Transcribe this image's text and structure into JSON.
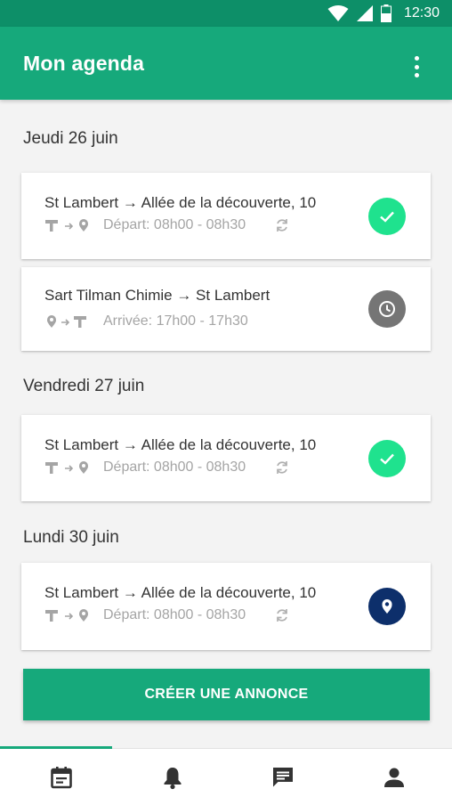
{
  "status_bar": {
    "time": "12:30"
  },
  "app_bar": {
    "title": "Mon agenda"
  },
  "days": [
    {
      "label": "Jeudi 26 juin",
      "trips": [
        {
          "route": "St Lambert → Allée de la découverte, 10",
          "schedule": "Départ: 08h00 - 08h30",
          "direction": "departure",
          "recurring": true,
          "status": "confirmed"
        },
        {
          "route": "Sart Tilman Chimie → St Lambert",
          "schedule": "Arrivée: 17h00 - 17h30",
          "direction": "arrival",
          "recurring": false,
          "status": "pending"
        }
      ]
    },
    {
      "label": "Vendredi 27 juin",
      "trips": [
        {
          "route": "St Lambert → Allée de la découverte, 10",
          "schedule": "Départ: 08h00 - 08h30",
          "direction": "departure",
          "recurring": true,
          "status": "confirmed"
        }
      ]
    },
    {
      "label": "Lundi 30 juin",
      "trips": [
        {
          "route": "St Lambert → Allée de la découverte, 10",
          "schedule": "Départ: 08h00 - 08h30",
          "direction": "departure",
          "recurring": true,
          "status": "location"
        }
      ]
    }
  ],
  "create_button": {
    "label": "CRÉER UNE ANNONCE"
  },
  "bottom_nav": {
    "active_index": 0,
    "items": [
      {
        "icon": "calendar-icon"
      },
      {
        "icon": "bell-icon"
      },
      {
        "icon": "message-icon"
      },
      {
        "icon": "person-icon"
      }
    ]
  },
  "colors": {
    "primary": "#16a97b",
    "primary_dark": "#0d8f68",
    "confirmed": "#1fe28e",
    "pending": "#757575",
    "location": "#0d2f6b",
    "muted_text": "#a5a5a5"
  }
}
